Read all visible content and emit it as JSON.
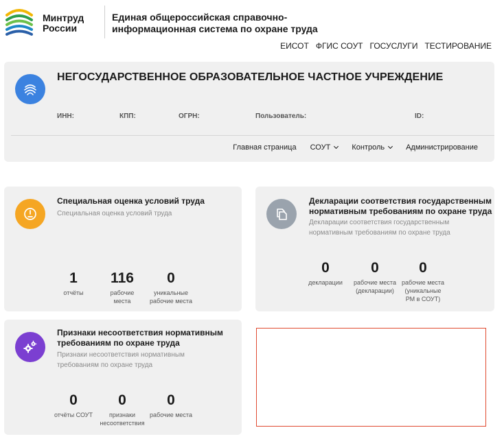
{
  "brand": {
    "logo_line1": "Минтруд",
    "logo_line2": "России",
    "site_title_line1": "Единая общероссийская справочно-",
    "site_title_line2": "информационная система по охране труда"
  },
  "top_nav": [
    "ЕИСОТ",
    "ФГИС СОУТ",
    "ГОСУСЛУГИ",
    "ТЕСТИРОВАНИЕ"
  ],
  "org": {
    "title": "НЕГОСУДАРСТВЕННОЕ ОБРАЗОВАТЕЛЬНОЕ ЧАСТНОЕ УЧРЕЖДЕНИЕ",
    "inn_label": "ИНН:",
    "kpp_label": "КПП:",
    "ogrn_label": "ОГРН:",
    "user_label": "Пользователь:",
    "id_label": "ID:",
    "nav": {
      "home": "Главная страница",
      "sout": "СОУТ",
      "control": "Контроль",
      "admin": "Администрирование"
    }
  },
  "tiles": {
    "sout": {
      "title": "Специальная оценка условий труда",
      "subtitle": "Специальная оценка условий труда",
      "stats": [
        {
          "value": "1",
          "label1": "отчёты",
          "label2": ""
        },
        {
          "value": "116",
          "label1": "рабочие",
          "label2": "места"
        },
        {
          "value": "0",
          "label1": "уникальные",
          "label2": "рабочие места"
        }
      ]
    },
    "declarations": {
      "title_line1": "Декларации соответствия государственным",
      "title_line2": "нормативным требованиям по охране труда",
      "subtitle_line1": "Декларации соответствия государственным",
      "subtitle_line2": "нормативным требованиям по охране труда",
      "stats": [
        {
          "value": "0",
          "label1": "декларации",
          "label2": "",
          "label3": ""
        },
        {
          "value": "0",
          "label1": "рабочие места",
          "label2": "(декларации)",
          "label3": ""
        },
        {
          "value": "0",
          "label1": "рабочие места",
          "label2": "(уникальные",
          "label3": "РМ в СОУТ)"
        }
      ]
    },
    "violations": {
      "title_line1": "Признаки несоответствия нормативным",
      "title_line2": "требованиям по охране труда",
      "subtitle_line1": "Признаки несоответствия нормативным",
      "subtitle_line2": "требованиям по охране труда",
      "stats": [
        {
          "value": "0",
          "label1": "отчёты СОУТ",
          "label2": ""
        },
        {
          "value": "0",
          "label1": "признаки",
          "label2": "несоответствия"
        },
        {
          "value": "0",
          "label1": "рабочие места",
          "label2": ""
        }
      ]
    }
  },
  "colors": {
    "org_avatar": "#3b82e0",
    "sout_icon": "#f5a623",
    "declarations_icon": "#9aa3ad",
    "violations_icon": "#7b3fd1",
    "highlight_border": "#e04a30"
  },
  "icons": {
    "logo": "mintrud-logo-icon",
    "org": "fingerprint-icon",
    "sout": "gauge-icon",
    "declarations": "documents-icon",
    "violations": "gears-icon"
  }
}
